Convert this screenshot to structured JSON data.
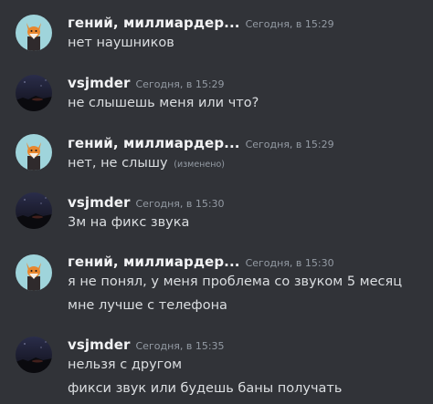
{
  "colors": {
    "background": "#313338",
    "username": "#f2f3f5",
    "message_text": "#dbdee1",
    "muted_text": "#949ba4",
    "fox_avatar_bg": "#9fd4db",
    "night_avatar_bg": "#1d1f33"
  },
  "messages": [
    {
      "avatar_icon": "fox-avatar-icon",
      "author": "гений, миллиардер...",
      "timestamp": "Сегодня, в 15:29",
      "lines": [
        "нет наушников"
      ]
    },
    {
      "avatar_icon": "night-sky-avatar-icon",
      "author": "vsjmder",
      "timestamp": "Сегодня, в 15:29",
      "lines": [
        "не слышешь меня или что?"
      ]
    },
    {
      "avatar_icon": "fox-avatar-icon",
      "author": "гений, миллиардер...",
      "timestamp": "Сегодня, в 15:29",
      "lines": [
        "нет, не слышу"
      ],
      "edited_label": "(изменено)"
    },
    {
      "avatar_icon": "night-sky-avatar-icon",
      "author": "vsjmder",
      "timestamp": "Сегодня, в 15:30",
      "lines": [
        "3м на фикс звука"
      ]
    },
    {
      "avatar_icon": "fox-avatar-icon",
      "author": "гений, миллиардер...",
      "timestamp": "Сегодня, в 15:30",
      "lines": [
        "я не понял, у меня проблема со звуком 5 месяц",
        "мне лучше с телефона"
      ]
    },
    {
      "avatar_icon": "night-sky-avatar-icon",
      "author": "vsjmder",
      "timestamp": "Сегодня, в 15:35",
      "lines": [
        "нельзя с другом",
        "фикси звук или будешь баны получать"
      ]
    }
  ]
}
